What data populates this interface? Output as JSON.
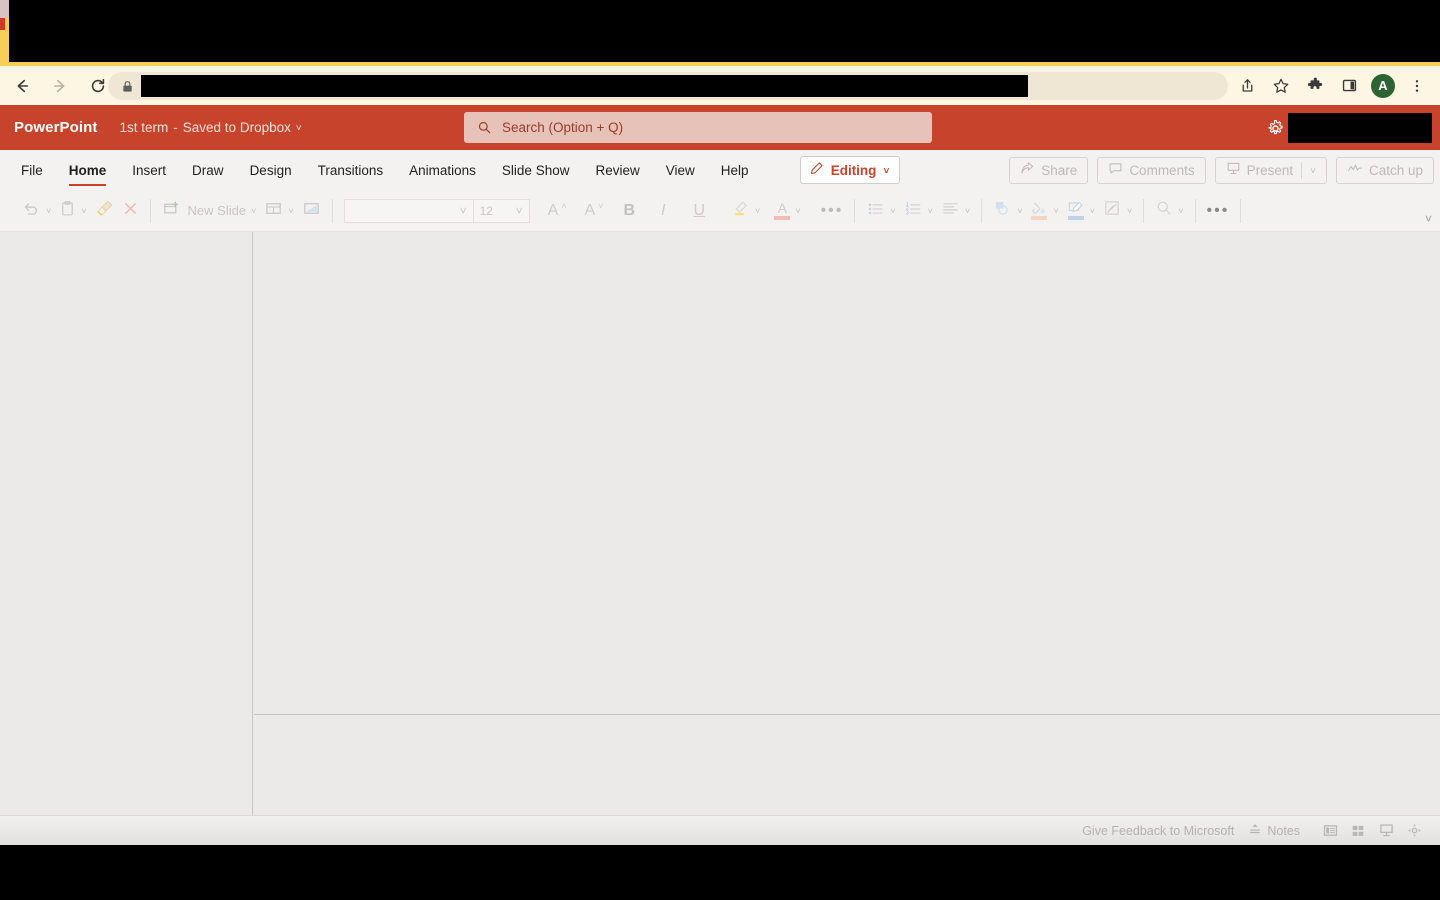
{
  "browser": {
    "back_title": "Back",
    "forward_title": "Forward",
    "reload_title": "Reload",
    "omnibox_value": "",
    "lock_icon": "lock-icon",
    "share_icon": "share-icon",
    "bookmark_icon": "star-icon",
    "extensions_icon": "puzzle-icon",
    "sidepanel_icon": "side-panel-icon",
    "avatar_initial": "A",
    "menu_icon": "kebab-menu-icon"
  },
  "header": {
    "brand": "PowerPoint",
    "file_name": "1st term",
    "separator": "-",
    "save_status": "Saved to Dropbox",
    "save_chevron": "˅",
    "gear_icon": "gear-icon"
  },
  "search": {
    "icon": "search-icon",
    "placeholder": "Search (Option + Q)"
  },
  "ribbon": {
    "tabs": [
      {
        "label": "File",
        "active": false
      },
      {
        "label": "Home",
        "active": true
      },
      {
        "label": "Insert",
        "active": false
      },
      {
        "label": "Draw",
        "active": false
      },
      {
        "label": "Design",
        "active": false
      },
      {
        "label": "Transitions",
        "active": false
      },
      {
        "label": "Animations",
        "active": false
      },
      {
        "label": "Slide Show",
        "active": false
      },
      {
        "label": "Review",
        "active": false
      },
      {
        "label": "View",
        "active": false
      },
      {
        "label": "Help",
        "active": false
      }
    ],
    "editing_label": "Editing",
    "editing_icon": "pencil-icon",
    "editing_chevron": "˅",
    "share_label": "Share",
    "share_icon": "share-arrow-icon",
    "comments_label": "Comments",
    "comments_icon": "comment-bubble-icon",
    "present_label": "Present",
    "present_icon": "present-screen-icon",
    "present_chevron": "˅",
    "catchup_label": "Catch up",
    "catchup_icon": "activity-line-icon",
    "collapse_chevron": "˅"
  },
  "toolbar": {
    "undo_label": "Undo",
    "undo_icon": "undo-arrow-icon",
    "paste_label": "Paste",
    "paste_icon": "clipboard-icon",
    "format_painter_label": "Format Painter",
    "format_painter_icon": "paintbrush-icon",
    "clear_formatting_label": "Clear Formatting",
    "clear_formatting_icon": "close-x-icon",
    "new_slide_label": "New Slide",
    "new_slide_icon": "new-slide-icon",
    "layout_label": "Layout",
    "layout_icon": "slide-layout-icon",
    "reset_label": "Reset",
    "reset_icon": "reset-slide-icon",
    "font_name": "",
    "font_size": "12",
    "grow_font_label": "A",
    "grow_font_icon": "grow-font-icon",
    "shrink_font_label": "A",
    "shrink_font_icon": "shrink-font-icon",
    "bold_label": "B",
    "italic_label": "I",
    "underline_label": "U",
    "highlight_icon": "text-highlight-icon",
    "font_color_label": "A",
    "font_color_icon": "font-color-icon",
    "more_font_label": "•••",
    "bullets_icon": "bullet-list-icon",
    "numbering_icon": "numbered-list-icon",
    "align_icon": "align-text-icon",
    "shapes_icon": "shapes-icon",
    "shape_fill_icon": "shape-fill-icon",
    "shape_outline_icon": "shape-outline-icon",
    "shape_effects_icon": "shape-effects-icon",
    "find_icon": "find-magnifier-icon",
    "more_label": "•••"
  },
  "statusbar": {
    "feedback_label": "Give Feedback to Microsoft",
    "notes_label": "Notes",
    "notes_icon": "notes-icon",
    "normal_view_icon": "normal-view-icon",
    "slide_sorter_icon": "slide-sorter-icon",
    "reading_view_icon": "reading-view-icon",
    "fit_window_icon": "fit-to-window-icon"
  },
  "colors": {
    "brand_red": "#c8432c",
    "ribbon_bg": "#f3f2f1",
    "workspace_bg": "#ebeae8",
    "browser_bg": "#fdf6e3",
    "avatar_green": "#2e6333"
  }
}
